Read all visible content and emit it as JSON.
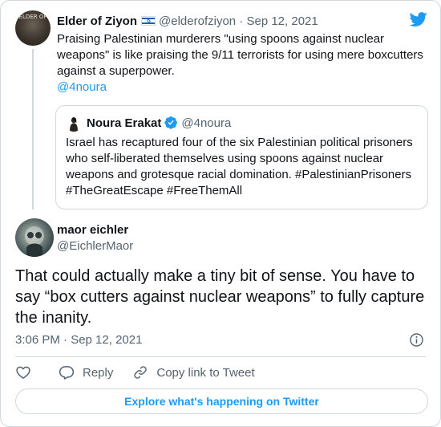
{
  "parent_tweet": {
    "author_name": "Elder of Ziyon",
    "avatar_text": "ELDER OF",
    "handle": "@elderofziyon",
    "separator": "·",
    "date": "Sep 12, 2021",
    "text": "Praising Palestinian murderers \"using spoons against nuclear weapons\" is like praising the 9/11 terrorists for using mere boxcutters against a superpower.",
    "mention": "@4noura"
  },
  "quoted_tweet": {
    "author_name": "Noura Erakat",
    "handle": "@4noura",
    "text": "Israel has recaptured four of the six Palestinian political prisoners who self-liberated themselves using spoons against nuclear weapons and grotesque racial domination. #PalestinianPrisoners #TheGreatEscape #FreeThemAll"
  },
  "main_tweet": {
    "author_name": "maor eichler",
    "handle": "@EichlerMaor",
    "text": "That could actually make a tiny bit of sense. You have to say “box cutters against nuclear weapons” to fully capture the inanity.",
    "timestamp": "3:06 PM · Sep 12, 2021"
  },
  "actions": {
    "reply_label": "Reply",
    "copy_link_label": "Copy link to Tweet"
  },
  "explore_label": "Explore what's happening on Twitter",
  "colors": {
    "accent": "#1d9bf0",
    "text": "#0f1419",
    "muted": "#536471",
    "border": "#cfd9de"
  }
}
